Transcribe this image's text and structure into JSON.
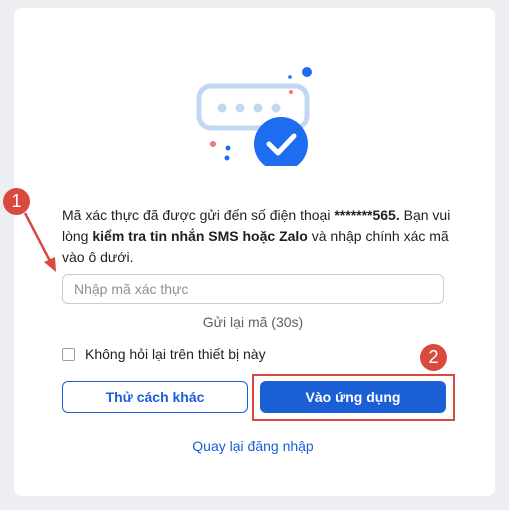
{
  "verification": {
    "message_prefix": "Mã xác thực đã được gửi đến số điện thoại ",
    "phone": "*******565.",
    "message_mid": "Bạn vui lòng ",
    "message_bold": "kiểm tra tin nhắn SMS hoặc Zalo",
    "message_suffix": " và nhập chính xác mã vào ô dưới.",
    "input_placeholder": "Nhập mã xác thực",
    "resend_label": "Gửi lại mã (30s)",
    "remember_label": "Không hỏi lại trên thiết bị này",
    "remember_checked": false
  },
  "actions": {
    "try_other_label": "Thử cách khác",
    "enter_app_label": "Vào ứng dụng",
    "back_to_login_label": "Quay lại đăng nhập"
  },
  "annotations": {
    "marker_1": "1",
    "marker_2": "2",
    "color": "#d84a3f"
  },
  "theme": {
    "accent": "#1a5fd6",
    "icon_blue": "#1e6cf0"
  }
}
